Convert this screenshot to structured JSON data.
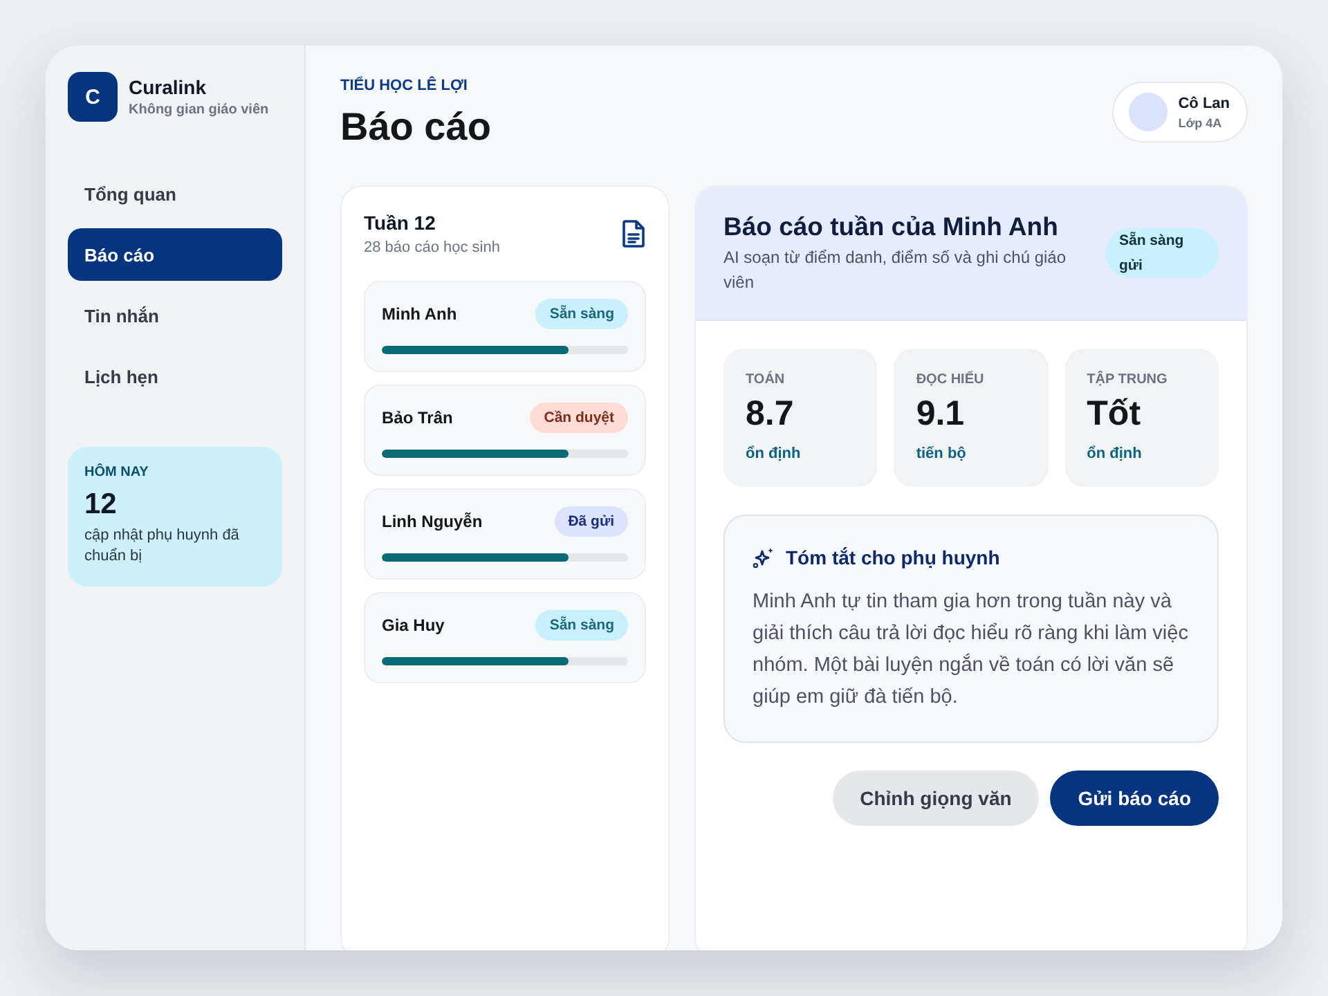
{
  "sidebar": {
    "logo": {
      "letter": "C",
      "name": "Curalink",
      "tagline": "Không gian giáo viên"
    },
    "nav": [
      {
        "label": "Tổng quan",
        "selected": false
      },
      {
        "label": "Báo cáo",
        "selected": true
      },
      {
        "label": "Tin nhắn",
        "selected": false
      },
      {
        "label": "Lịch hẹn",
        "selected": false
      }
    ],
    "today": {
      "label": "HÔM NAY",
      "count": "12",
      "text": "cập nhật phụ huynh đã chuẩn bị"
    }
  },
  "header": {
    "school": "TIỂU HỌC LÊ LỢI",
    "title": "Báo cáo",
    "user": {
      "name": "Cô Lan",
      "class": "Lớp 4A"
    }
  },
  "report_list": {
    "title": "Tuần 12",
    "subtitle": "28 báo cáo học sinh",
    "items": [
      {
        "name": "Minh Anh",
        "status": "Sẵn sàng",
        "color": "#c9f1fd",
        "level": 0.76
      },
      {
        "name": "Bảo Trân",
        "status": "Cần duyệt",
        "color": "#fddcd5",
        "level": 0.76
      },
      {
        "name": "Linh Nguyễn",
        "status": "Đã gửi",
        "color": "#dde3fd",
        "level": 0.76
      },
      {
        "name": "Gia Huy",
        "status": "Sẵn sàng",
        "color": "#c9f1fd",
        "level": 0.76
      }
    ]
  },
  "detail": {
    "title": "Báo cáo tuần của Minh Anh",
    "subtitle": "AI soạn từ điểm danh, điểm số và ghi chú giáo viên",
    "status": "Sẵn sàng gửi",
    "metrics": [
      {
        "label": "TOÁN",
        "value": "8.7",
        "note": "ổn định"
      },
      {
        "label": "ĐỌC HIỂU",
        "value": "9.1",
        "note": "tiến bộ"
      },
      {
        "label": "TẬP TRUNG",
        "value": "Tốt",
        "note": "ổn định"
      }
    ],
    "summary": {
      "title": "Tóm tắt cho phụ huynh",
      "text": "Minh Anh tự tin tham gia hơn trong tuần này và giải thích câu trả lời đọc hiểu rõ ràng khi làm việc nhóm. Một bài luyện ngắn về toán có lời văn sẽ giúp em giữ đà tiến bộ."
    },
    "buttons": [
      {
        "label": "Chỉnh giọng văn",
        "kind": "secondary"
      },
      {
        "label": "Gửi báo cáo",
        "kind": "primary"
      }
    ]
  }
}
